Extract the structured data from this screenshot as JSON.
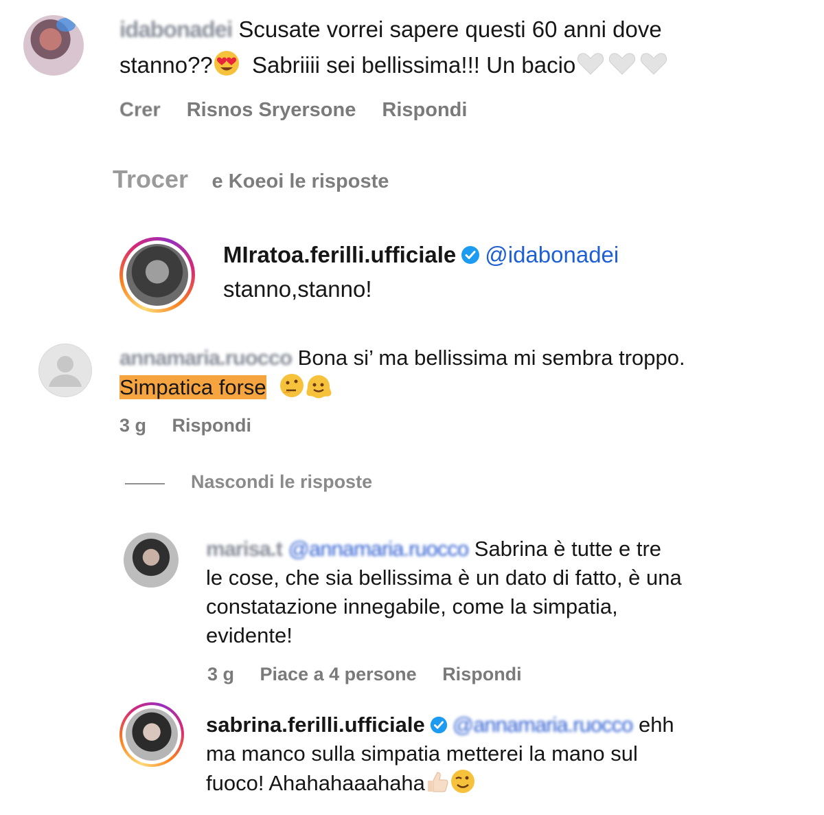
{
  "comment1": {
    "username": "idabonadei",
    "text_line1": "Scusate vorrei sapere questi 60 anni dove",
    "text_line2a": "stanno??",
    "text_line2b": "Sabriiii sei bellissima!!! Un bacio",
    "meta": [
      "Crer",
      "Risnos Sryersone",
      "Rispondi"
    ]
  },
  "replies_toggle1": {
    "left": "Trocer",
    "right": "e Koeoi le risposte"
  },
  "reply1": {
    "username": "MIratoa.ferilli.ufficiale",
    "mention": "@idabonadei",
    "text": "stanno,stanno!"
  },
  "comment2": {
    "username": "annamaria.ruocco",
    "text_line1": "Bona si’ ma bellissima mi sembra troppo.",
    "highlight": "Simpatica forse",
    "meta": [
      "3 g",
      "Rispondi"
    ]
  },
  "replies_toggle2": {
    "label": "Nascondi le risposte"
  },
  "reply2": {
    "username": "marisa.t",
    "mention": "@annamaria.ruocco",
    "line1": "Sabrina è tutte e tre",
    "line2": "le cose, che sia bellissima è un dato di fatto, è una",
    "line3": "constatazione innegabile, come la simpatia,",
    "line4": "evidente!",
    "meta": [
      "3 g",
      "Piace a 4 persone",
      "Rispondi"
    ]
  },
  "reply3": {
    "username": "sabrina.ferilli.ufficiale",
    "mention": "@annamaria.ruocco",
    "line1_end": "ehh",
    "line2": "ma manco sulla simpatia metterei la mano sul",
    "line3": "fuoco! Ahahahaaahaha"
  },
  "colors": {
    "verified": "#1d9bf0",
    "highlight": "#f5a440",
    "mention": "#1f5fd6",
    "meta": "#7a7a7a"
  },
  "icons": [
    "heart-eyes-emoji",
    "white-heart-emoji",
    "verified-badge-icon",
    "thinking-face-emoji",
    "melting-face-emoji",
    "thumbs-up-emoji",
    "winking-face-emoji",
    "default-avatar-icon"
  ]
}
